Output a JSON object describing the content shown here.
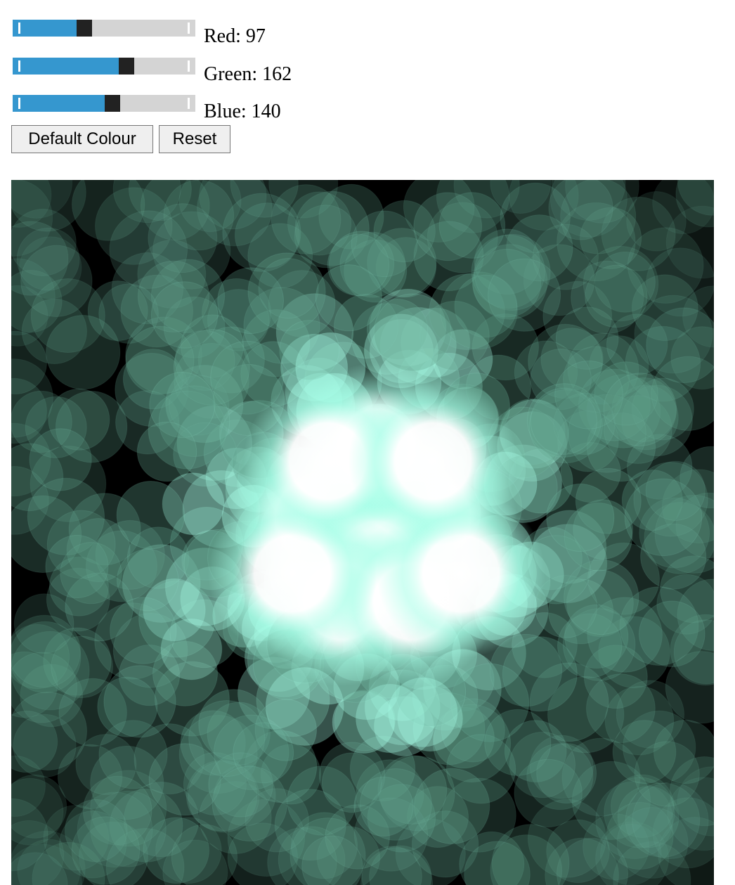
{
  "controls": {
    "red": {
      "label": "Red: 97",
      "value": 97,
      "max": 255
    },
    "green": {
      "label": "Green: 162",
      "value": 162,
      "max": 255
    },
    "blue": {
      "label": "Blue: 140",
      "value": 140,
      "max": 255
    },
    "default_button": "Default Colour",
    "reset_button": "Reset"
  },
  "colors": {
    "slider_fill": "#3597cf",
    "slider_track": "#d4d4d4",
    "slider_thumb": "#222222",
    "canvas_background": "#000000",
    "bubble_color": "#61a28c",
    "highlight_color": "#a8ffe8"
  },
  "canvas": {
    "description_type": "bokeh-circles"
  }
}
